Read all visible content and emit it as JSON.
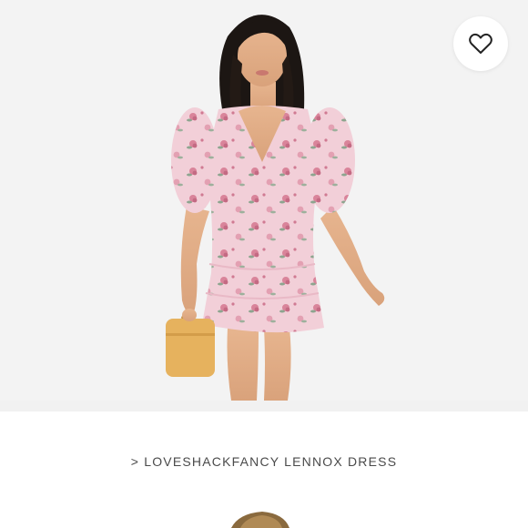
{
  "product": {
    "link_prefix": ">",
    "title": "LOVESHACKFANCY LENNOX DRESS"
  },
  "icons": {
    "favorite": "heart-outline-icon"
  },
  "colors": {
    "dress_pink": "#f2cfd8",
    "bag_tan": "#e6b25e",
    "text_gray": "#4a4a4a"
  }
}
